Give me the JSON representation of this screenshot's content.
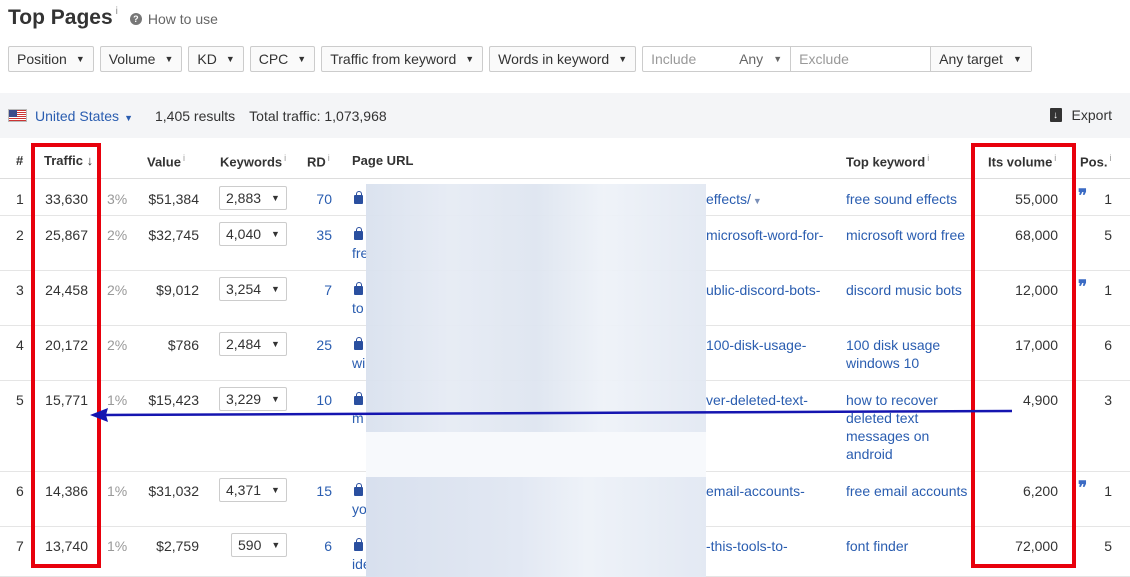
{
  "header": {
    "title": "Top Pages",
    "title_info": "i",
    "howto_icon": "?",
    "howto_label": "How to use"
  },
  "filters": [
    {
      "label": "Position"
    },
    {
      "label": "Volume"
    },
    {
      "label": "KD"
    },
    {
      "label": "CPC"
    },
    {
      "label": "Traffic from keyword"
    },
    {
      "label": "Words in keyword"
    }
  ],
  "include": {
    "placeholder": "Include",
    "any_label": "Any",
    "exclude_placeholder": "Exclude",
    "target_label": "Any target"
  },
  "summary": {
    "country": "United States",
    "results": "1,405 results",
    "total_traffic": "Total traffic: 1,073,968",
    "export_label": "Export"
  },
  "columns": {
    "index": "#",
    "traffic": "Traffic",
    "traffic_sort": "↓",
    "value": "Value",
    "keywords": "Keywords",
    "rd": "RD",
    "url": "Page URL",
    "top_keyword": "Top keyword",
    "its_volume": "Its volume",
    "pos": "Pos.",
    "info": "i"
  },
  "rows": [
    {
      "n": "1",
      "traffic": "33,630",
      "pct": "3%",
      "value": "$51,384",
      "keywords": "2,883",
      "rd": "70",
      "url_tail": "effects/",
      "url_line2": "",
      "top_keyword": "free sound effects",
      "volume": "55,000",
      "quote": true,
      "pos": "1"
    },
    {
      "n": "2",
      "traffic": "25,867",
      "pct": "2%",
      "value": "$32,745",
      "keywords": "4,040",
      "rd": "35",
      "url_tail": "microsoft-word-for-",
      "url_line2": "fre",
      "top_keyword": "microsoft word free",
      "volume": "68,000",
      "quote": false,
      "pos": "5"
    },
    {
      "n": "3",
      "traffic": "24,458",
      "pct": "2%",
      "value": "$9,012",
      "keywords": "3,254",
      "rd": "7",
      "url_tail": "ublic-discord-bots-",
      "url_line2": "to",
      "top_keyword": "discord music bots",
      "volume": "12,000",
      "quote": true,
      "pos": "1"
    },
    {
      "n": "4",
      "traffic": "20,172",
      "pct": "2%",
      "value": "$786",
      "keywords": "2,484",
      "rd": "25",
      "url_tail": "100-disk-usage-",
      "url_line2": "wi",
      "top_keyword": "100 disk usage windows 10",
      "volume": "17,000",
      "quote": false,
      "pos": "6"
    },
    {
      "n": "5",
      "traffic": "15,771",
      "pct": "1%",
      "value": "$15,423",
      "keywords": "3,229",
      "rd": "10",
      "url_tail": "ver-deleted-text-",
      "url_line2": "m",
      "top_keyword": "how to recover deleted text messages on android",
      "volume": "4,900",
      "quote": false,
      "pos": "3"
    },
    {
      "n": "6",
      "traffic": "14,386",
      "pct": "1%",
      "value": "$31,032",
      "keywords": "4,371",
      "rd": "15",
      "url_tail": "email-accounts-",
      "url_line2": "yo",
      "top_keyword": "free email accounts",
      "volume": "6,200",
      "quote": true,
      "pos": "1"
    },
    {
      "n": "7",
      "traffic": "13,740",
      "pct": "1%",
      "value": "$2,759",
      "keywords": "590",
      "rd": "6",
      "url_tail": "-this-tools-to-",
      "url_line2": "ide",
      "top_keyword": "font finder",
      "volume": "72,000",
      "quote": false,
      "pos": "5"
    }
  ],
  "annotation_colors": {
    "box": "#e8000c",
    "arrow": "#1515b0"
  }
}
